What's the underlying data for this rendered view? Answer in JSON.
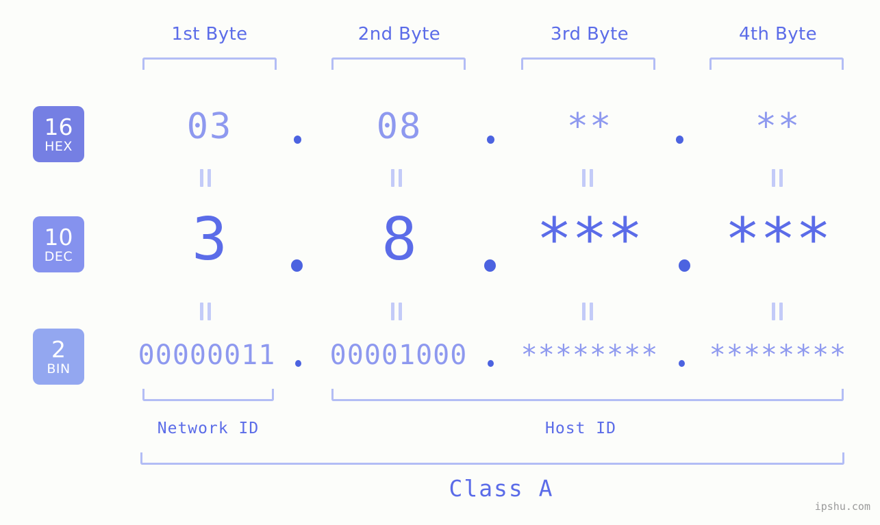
{
  "meta": {
    "background_color": "#fcfdfa",
    "accent_color": "#5b6ce8",
    "accent_light": "#8e99ef",
    "bracket_color": "#b3bdf5",
    "watermark": "ipshu.com"
  },
  "byte_headers": [
    {
      "label": "1st Byte"
    },
    {
      "label": "2nd Byte"
    },
    {
      "label": "3rd Byte"
    },
    {
      "label": "4th Byte"
    }
  ],
  "rows": [
    {
      "key": "hex",
      "badge_number": "16",
      "badge_abbr": "HEX",
      "badge_color": "#757fe3",
      "values": [
        "03",
        "08",
        "**",
        "**"
      ],
      "separator": "."
    },
    {
      "key": "dec",
      "badge_number": "10",
      "badge_abbr": "DEC",
      "badge_color": "#8592ee",
      "values": [
        "3",
        "8",
        "***",
        "***"
      ],
      "separator": "."
    },
    {
      "key": "bin",
      "badge_number": "2",
      "badge_abbr": "BIN",
      "badge_color": "#93a7f0",
      "values": [
        "00000011",
        "00001000",
        "********",
        "********"
      ],
      "separator": "."
    }
  ],
  "equal_marks": {
    "glyph": "="
  },
  "id_labels": {
    "network": "Network ID",
    "host": "Host ID"
  },
  "class_label": "Class A"
}
